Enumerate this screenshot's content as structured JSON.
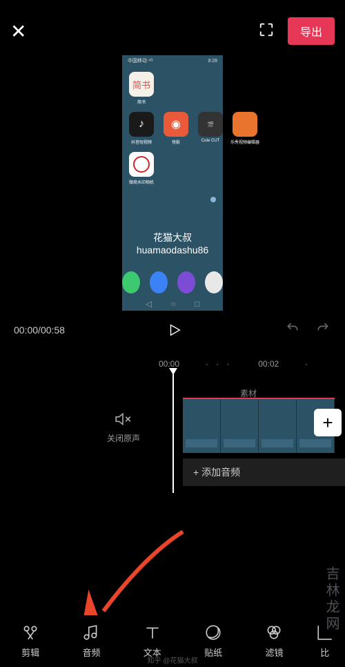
{
  "header": {
    "export_label": "导出"
  },
  "preview": {
    "phone_time": "9:28",
    "apps": {
      "row1": [
        {
          "name": "简书",
          "bg": "#f5f1e8",
          "color": "#d4524e"
        }
      ],
      "row2": [
        {
          "name": "抖音短视频",
          "bg": "#1a1a1a"
        },
        {
          "name": "快影",
          "bg": "#e85a3a"
        },
        {
          "name": "Cute CUT",
          "bg": "#222"
        },
        {
          "name": "乐秀视频编辑器",
          "bg": "#e8742e"
        }
      ],
      "row3": [
        {
          "name": "微商水印相机",
          "bg": "#fff"
        }
      ]
    },
    "watermark_cn": "花猫大叔",
    "watermark_en": "huamaodashu86"
  },
  "transport": {
    "current_time": "00:00",
    "total_time": "00:58"
  },
  "ruler": {
    "t1": "00:00",
    "t2": "00:02"
  },
  "timeline": {
    "cover_label": "素材",
    "mute_label": "关闭原声",
    "add_audio_label": "+  添加音频"
  },
  "tools": {
    "edit": "剪辑",
    "audio": "音频",
    "text": "文本",
    "sticker": "贴纸",
    "filter": "滤镜",
    "ratio": "比"
  },
  "site_watermark": "吉林龙网",
  "attribution": "知乎 @花猫大叔"
}
